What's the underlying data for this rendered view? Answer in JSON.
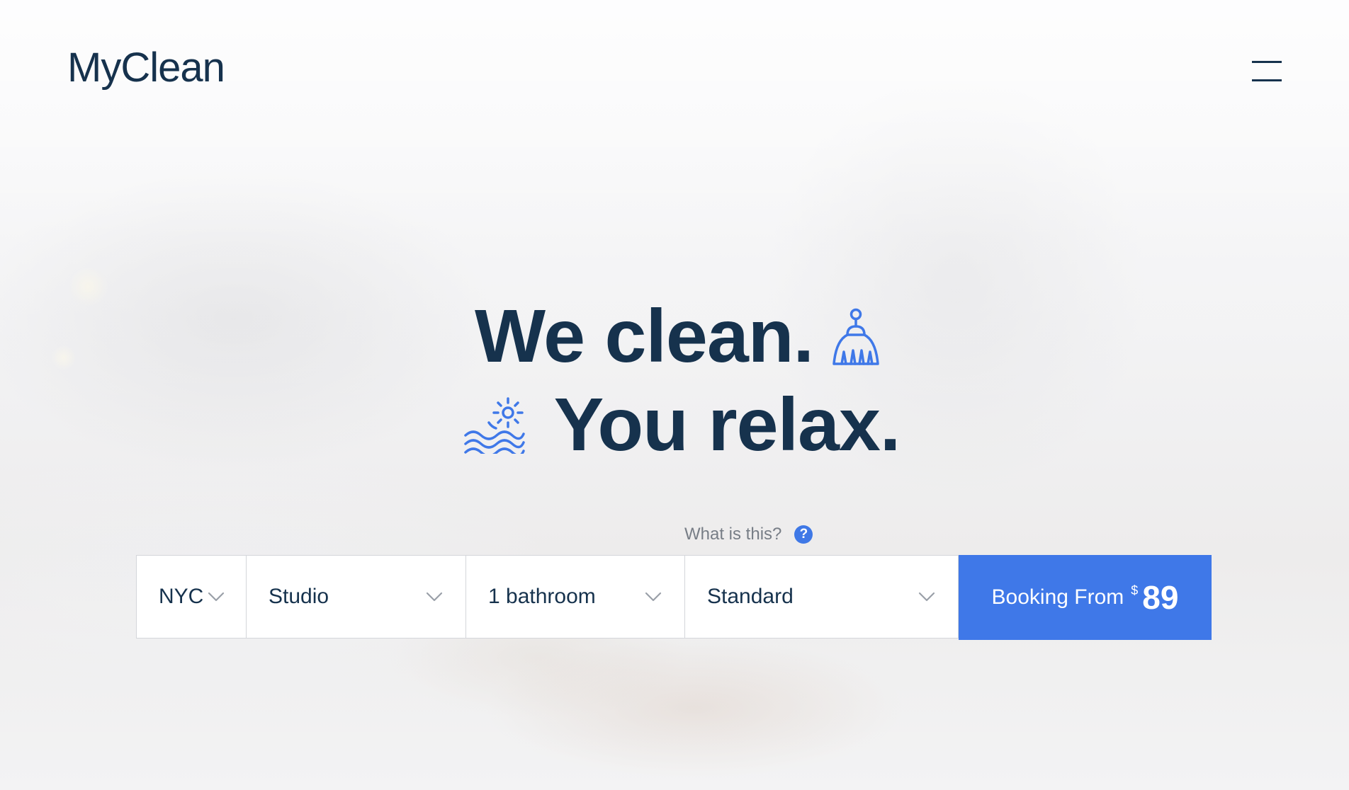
{
  "header": {
    "logo": "MyClean",
    "menu_icon": "hamburger-menu-icon"
  },
  "hero": {
    "headline_line1": "We clean.",
    "headline_line2": "You relax.",
    "icon_line1": "broom-icon",
    "icon_line2": "sun-over-waves-icon",
    "accent_color": "#3f78e8",
    "text_color": "#16324d"
  },
  "booking": {
    "help_text": "What is this?",
    "help_icon": "question-mark-icon",
    "city": "NYC",
    "size": "Studio",
    "bathrooms": "1 bathroom",
    "service_type": "Standard",
    "button_label": "Booking From",
    "currency": "$",
    "price": "89"
  }
}
